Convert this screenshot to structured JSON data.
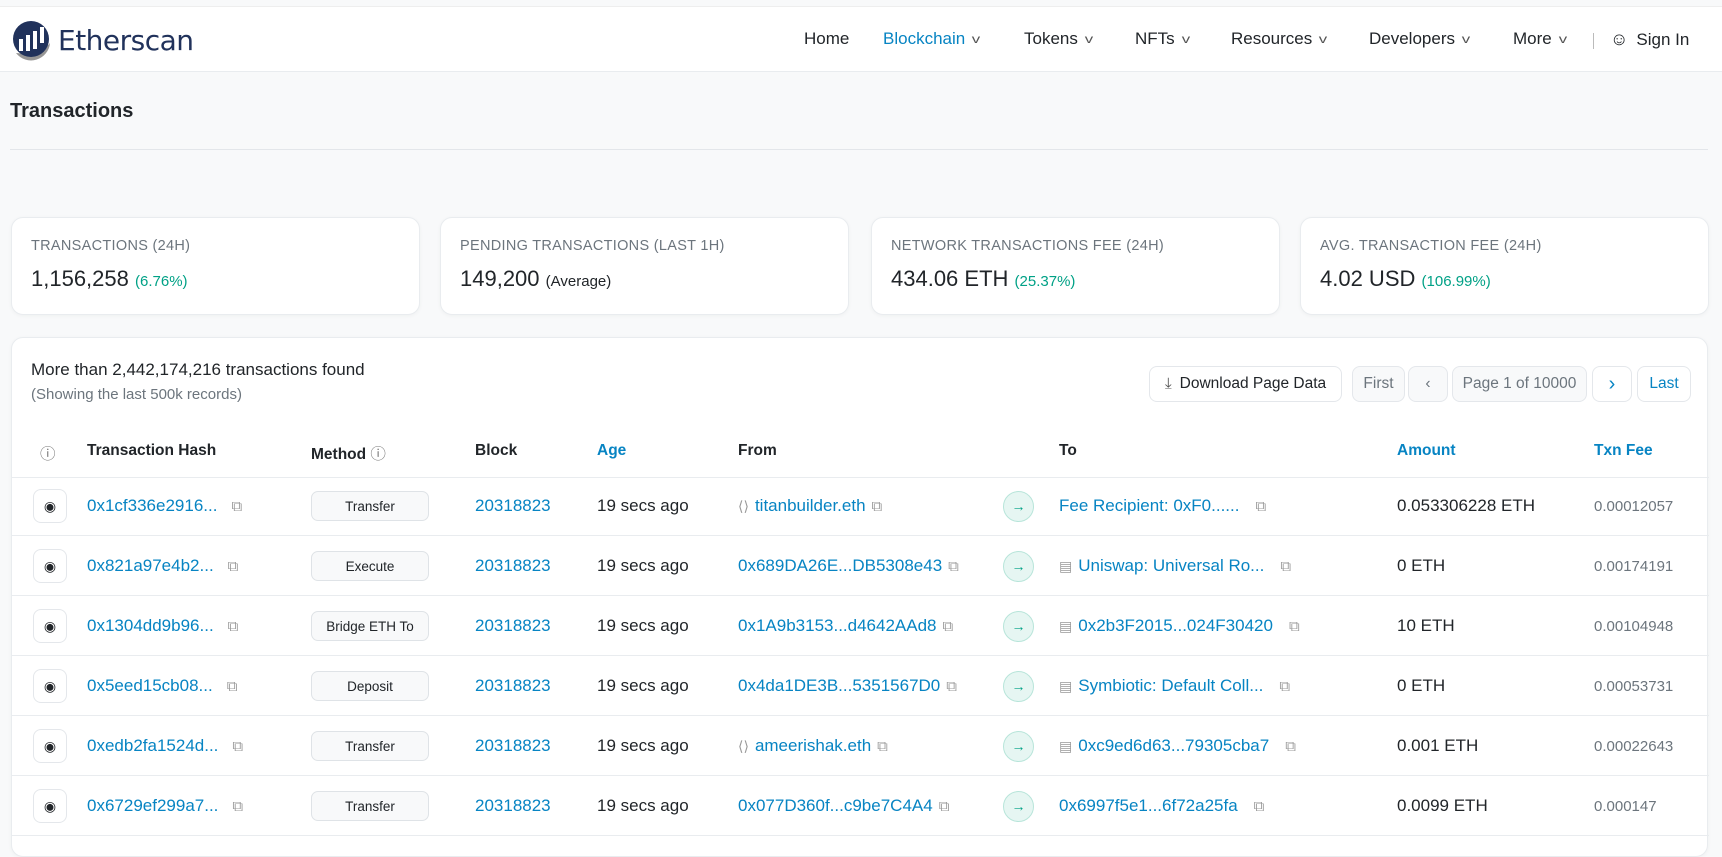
{
  "nav": {
    "brand": "Etherscan",
    "items": [
      "Home",
      "Blockchain",
      "Tokens",
      "NFTs",
      "Resources",
      "Developers",
      "More"
    ],
    "active": "Blockchain",
    "sign_in": "Sign In"
  },
  "page_title": "Transactions",
  "stats": [
    {
      "label": "TRANSACTIONS (24H)",
      "value": "1,156,258",
      "note": "(6.76%)",
      "note_green": true
    },
    {
      "label": "PENDING TRANSACTIONS (LAST 1H)",
      "value": "149,200",
      "note": "(Average)",
      "note_green": false
    },
    {
      "label": "NETWORK TRANSACTIONS FEE (24H)",
      "value": "434.06 ETH",
      "note": "(25.37%)",
      "note_green": true
    },
    {
      "label": "AVG. TRANSACTION FEE (24H)",
      "value": "4.02 USD",
      "note": "(106.99%)",
      "note_green": true
    }
  ],
  "table": {
    "found": "More than 2,442,174,216 transactions found",
    "showing": "(Showing the last 500k records)",
    "download": "Download Page Data",
    "pagination": {
      "first": "First",
      "page": "Page 1 of 10000",
      "last": "Last"
    },
    "headers": {
      "hash": "Transaction Hash",
      "method": "Method",
      "block": "Block",
      "age": "Age",
      "from": "From",
      "to": "To",
      "amount": "Amount",
      "fee": "Txn Fee"
    },
    "rows": [
      {
        "hash": "0x1cf336e2916...",
        "method": "Transfer",
        "block": "20318823",
        "age": "19 secs ago",
        "from": "titanbuilder.eth",
        "from_type": "ens",
        "to": "Fee Recipient: 0xF0......",
        "to_type": "plain",
        "amount": "0.053306228 ETH",
        "fee": "0.00012057"
      },
      {
        "hash": "0x821a97e4b2...",
        "method": "Execute",
        "block": "20318823",
        "age": "19 secs ago",
        "from": "0x689DA26E...DB5308e43",
        "from_type": "plain",
        "to": "Uniswap: Universal Ro...",
        "to_type": "contract",
        "amount": "0 ETH",
        "fee": "0.00174191"
      },
      {
        "hash": "0x1304dd9b96...",
        "method": "Bridge ETH To",
        "block": "20318823",
        "age": "19 secs ago",
        "from": "0x1A9b3153...d4642AAd8",
        "from_type": "plain",
        "to": "0x2b3F2015...024F30420",
        "to_type": "contract",
        "amount": "10 ETH",
        "fee": "0.00104948"
      },
      {
        "hash": "0x5eed15cb08...",
        "method": "Deposit",
        "block": "20318823",
        "age": "19 secs ago",
        "from": "0x4da1DE3B...5351567D0",
        "from_type": "plain",
        "to": "Symbiotic: Default Coll...",
        "to_type": "contract",
        "amount": "0 ETH",
        "fee": "0.00053731"
      },
      {
        "hash": "0xedb2fa1524d...",
        "method": "Transfer",
        "block": "20318823",
        "age": "19 secs ago",
        "from": "ameerishak.eth",
        "from_type": "ens",
        "to": "0xc9ed6d63...79305cba7",
        "to_type": "contract",
        "amount": "0.001 ETH",
        "fee": "0.00022643"
      },
      {
        "hash": "0x6729ef299a7...",
        "method": "Transfer",
        "block": "20318823",
        "age": "19 secs ago",
        "from": "0x077D360f...c9be7C4A4",
        "from_type": "plain",
        "to": "0x6997f5e1...6f72a25fa",
        "to_type": "plain",
        "amount": "0.0099 ETH",
        "fee": "0.000147"
      }
    ]
  },
  "colors": {
    "link": "#0784c3",
    "green": "#00a186",
    "brand": "#21325b"
  }
}
